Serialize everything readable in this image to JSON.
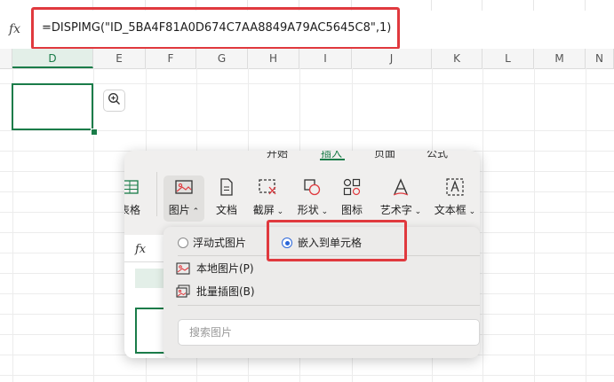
{
  "formula_bar": {
    "fx_label": "fx",
    "formula": "=DISPIMG(\"ID_5BA4F81A0D674C7AA8849A79AC5645C8\",1)"
  },
  "columns": [
    "D",
    "E",
    "F",
    "G",
    "H",
    "I",
    "J",
    "K",
    "L",
    "M",
    "N"
  ],
  "active_column": "D",
  "inset": {
    "tabs_peek": [
      "开始",
      "插入",
      "页面",
      "公式"
    ],
    "ribbon": {
      "table_label": "表格",
      "picture_label": "图片",
      "text_label": "文档",
      "screenshot_label": "截屏",
      "shape_label": "形状",
      "icon_label": "图标",
      "wordart_label": "艺术字",
      "textbox_label": "文本框"
    },
    "sheet_fx": "fx",
    "dropdown": {
      "float_option": "浮动式图片",
      "embed_option": "嵌入到单元格",
      "embed_selected": true,
      "local_picture": "本地图片(P)",
      "batch_insert": "批量插图(B)",
      "search_placeholder": "搜索图片"
    }
  },
  "colors": {
    "accent_green": "#1a7c49",
    "highlight_red": "#e0393e",
    "radio_blue": "#2a66d9"
  }
}
